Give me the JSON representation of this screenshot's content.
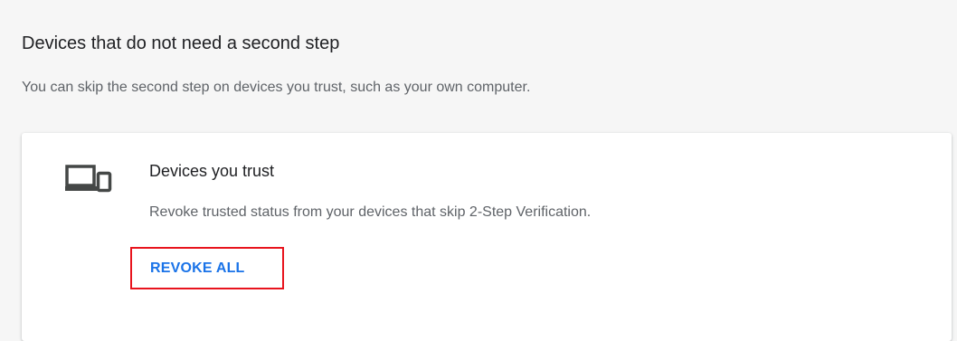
{
  "section": {
    "title": "Devices that do not need a second step",
    "description": "You can skip the second step on devices you trust, such as your own computer."
  },
  "card": {
    "icon": "devices-icon",
    "title": "Devices you trust",
    "description": "Revoke trusted status from your devices that skip 2-Step Verification.",
    "revoke_label": "REVOKE ALL"
  },
  "colors": {
    "page_background": "#f6f6f6",
    "card_background": "#ffffff",
    "link_blue": "#1a73e8",
    "highlight_red": "#e8141d",
    "text_primary": "#202124",
    "text_secondary": "#5f6368"
  }
}
